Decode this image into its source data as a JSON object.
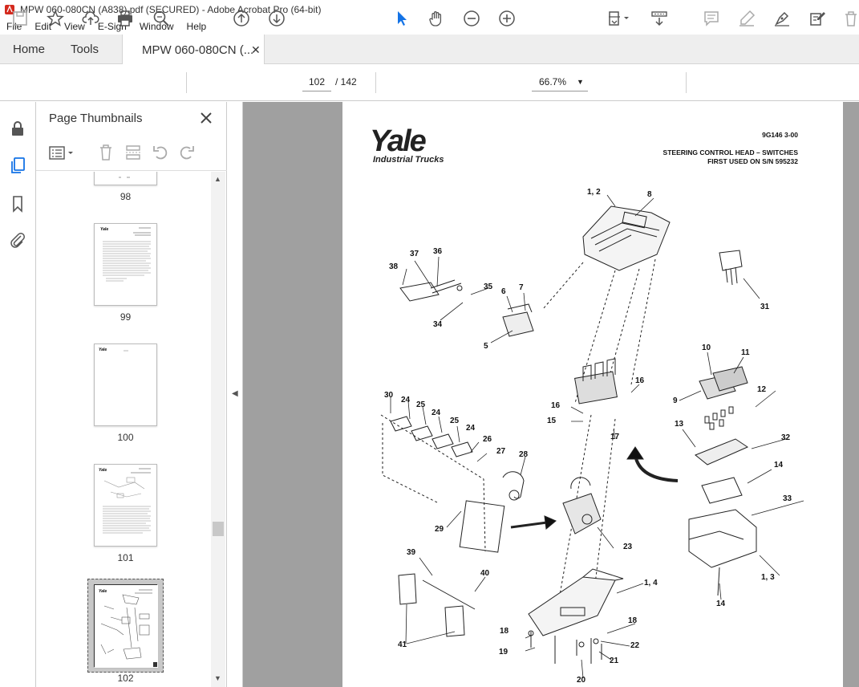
{
  "window": {
    "title": "MPW 060-080CN (A838).pdf (SECURED) - Adobe Acrobat Pro (64-bit)"
  },
  "menu": [
    "File",
    "Edit",
    "View",
    "E-Sign",
    "Window",
    "Help"
  ],
  "tabs": {
    "home": "Home",
    "tools": "Tools",
    "doc": "MPW 060-080CN (..."
  },
  "toolbar": {
    "page_current": "102",
    "page_total": "/  142",
    "zoom": "66.7%"
  },
  "panel": {
    "title": "Page Thumbnails",
    "thumbs": [
      {
        "label": "98"
      },
      {
        "label": "99"
      },
      {
        "label": "100"
      },
      {
        "label": "101"
      },
      {
        "label": "102"
      }
    ]
  },
  "document": {
    "brand": "Yale",
    "brand_sub": "Industrial Trucks",
    "code": "9G146    3-00",
    "title1": "STEERING CONTROL HEAD – SWITCHES",
    "title2": "FIRST USED ON S/N 595232",
    "callouts": [
      "1, 2",
      "8",
      "31",
      "37",
      "36",
      "38",
      "35",
      "6",
      "7",
      "34",
      "5",
      "10",
      "11",
      "9",
      "12",
      "16",
      "16",
      "15",
      "17",
      "13",
      "32",
      "14",
      "33",
      "1, 3",
      "14",
      "30",
      "24",
      "25",
      "24",
      "25",
      "24",
      "26",
      "27",
      "28",
      "29",
      "23",
      "39",
      "40",
      "1, 4",
      "41",
      "18",
      "18",
      "19",
      "22",
      "21",
      "20"
    ]
  }
}
